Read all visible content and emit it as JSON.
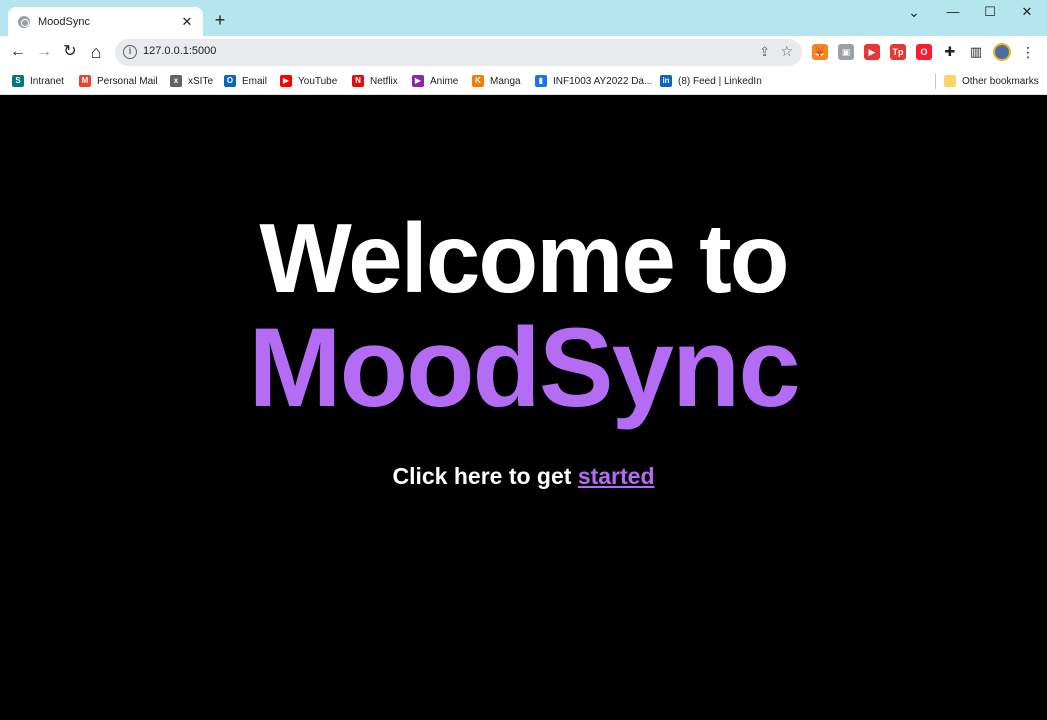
{
  "tab": {
    "title": "MoodSync",
    "close": "✕",
    "new_tab": "+"
  },
  "window_controls": {
    "chevron": "⌄",
    "minimize": "—",
    "maximize": "☐",
    "close": "✕"
  },
  "toolbar": {
    "back": "←",
    "forward": "→",
    "reload": "↻",
    "home": "⌂",
    "url": "127.0.0.1:5000",
    "info": "i",
    "share": "⇪",
    "bookmark_star": "☆",
    "menu": "⋮"
  },
  "extensions": [
    {
      "name": "metamask",
      "glyph": "🦊",
      "color": "#f6851b"
    },
    {
      "name": "ext-gray",
      "glyph": "▣",
      "color": "#9aa0a6"
    },
    {
      "name": "ext-red-play",
      "glyph": "▶",
      "color": "#e53935"
    },
    {
      "name": "teleparty",
      "glyph": "Tp",
      "color": "#e53935"
    },
    {
      "name": "opera",
      "glyph": "O",
      "color": "#ff1b2d"
    },
    {
      "name": "extensions-puzzle",
      "glyph": "✚",
      "color": "#202124"
    },
    {
      "name": "side-panel",
      "glyph": "▥",
      "color": "#202124"
    }
  ],
  "bookmarks": [
    {
      "label": "Intranet",
      "icon": "S",
      "color": "#03787c"
    },
    {
      "label": "Personal Mail",
      "icon": "M",
      "color": "#ea4335"
    },
    {
      "label": "xSITe",
      "icon": "x",
      "color": "#5f6368"
    },
    {
      "label": "Email",
      "icon": "O",
      "color": "#0a64c8"
    },
    {
      "label": "YouTube",
      "icon": "▶",
      "color": "#ff0000"
    },
    {
      "label": "Netflix",
      "icon": "N",
      "color": "#e50914"
    },
    {
      "label": "Anime",
      "icon": "▶",
      "color": "#8e24aa"
    },
    {
      "label": "Manga",
      "icon": "K",
      "color": "#f57c00"
    },
    {
      "label": "INF1003 AY2022 Da...",
      "icon": "▮",
      "color": "#1a73e8"
    },
    {
      "label": "(8) Feed | LinkedIn",
      "icon": "in",
      "color": "#0a66c2"
    }
  ],
  "other_bookmarks": "Other bookmarks",
  "page": {
    "welcome": "Welcome to",
    "brand": "MoodSync",
    "cta_prefix": "Click here to get ",
    "cta_link": "started"
  }
}
